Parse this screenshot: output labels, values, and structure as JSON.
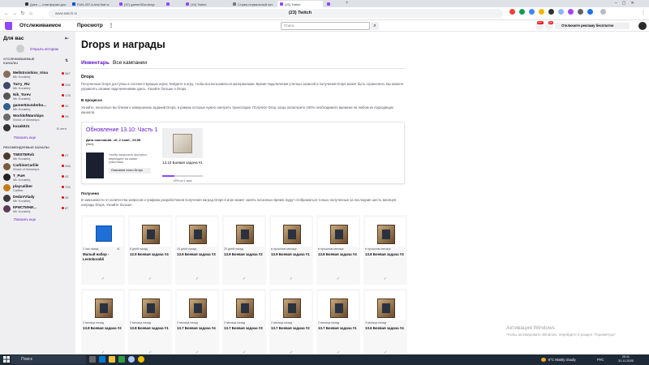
{
  "browser": {
    "tabs": [
      {
        "title": "Дзен — платформа для"
      },
      {
        "title": "FUN-337 A-test that w"
      },
      {
        "title": "(37) gamer52undergr"
      },
      {
        "title": ""
      },
      {
        "title": "(19) Twitch"
      },
      {
        "title": "Стрим-нервальный чат"
      },
      {
        "title": "(23) Twitch"
      },
      {
        "title": ""
      }
    ],
    "url": "www.twitch.tv",
    "page_title": "(23) Twitch"
  },
  "topnav": {
    "following": "Отслеживаемое",
    "browse": "Просмотр",
    "search_placeholder": "Поиск",
    "badge1": "99+",
    "badge2": "66",
    "adfree": "Отключите рекламу бесплатно"
  },
  "sidebar": {
    "heading": "Для вас",
    "history": "Открыть историю",
    "followed_header": "ОТСЛЕЖИВАЕМЫЕ КАНАЛЫ",
    "followed": [
      {
        "name": "Mellstroishiss_Irina",
        "game": "Mir Korablej",
        "viewers": "387",
        "color": "#8a6d5a"
      },
      {
        "name": "Turry_RU",
        "game": "Mir Korablej",
        "viewers": "226",
        "color": "#3b4a6b"
      },
      {
        "name": "Nik_Torev",
        "game": "Mir Korablej",
        "viewers": "178",
        "color": "#555"
      },
      {
        "name": "gamer52underbo...",
        "game": "Mir Korablej",
        "viewers": "42",
        "color": "#2f5f8f"
      },
      {
        "name": "WorldofWarships",
        "game": "World of Warships",
        "viewers": "28",
        "color": "#6b6b6b"
      },
      {
        "name": "kozak021",
        "game": "",
        "viewers": "В сети",
        "color": "#333"
      }
    ],
    "followed_more": "Показать еще",
    "recommended_header": "РЕКОМЕНДУЕМЫЕ КАНАЛЫ",
    "recommended": [
      {
        "name": "TWISTERvb",
        "game": "Mir Korablej",
        "viewers": "27",
        "color": "#4b3a2a"
      },
      {
        "name": "CarbinoCarlile",
        "game": "World of Warships",
        "viewers": "266",
        "color": "#7b5a3c"
      },
      {
        "name": "T_PuH",
        "game": "Mir Korablej",
        "viewers": "43",
        "color": "#222"
      },
      {
        "name": "playcaliber",
        "game": "Caliber",
        "viewers": "726",
        "color": "#c47a1a"
      },
      {
        "name": "DedaVVlady",
        "game": "Mir Korablej",
        "viewers": "35",
        "color": "#3a3a3a"
      },
      {
        "name": "КРИСТИНИ...",
        "game": "Mir Korablej",
        "viewers": "87",
        "color": "#5a3a5a"
      }
    ],
    "recommended_more": "Показать еще"
  },
  "main": {
    "title": "Drops и награды",
    "tab_inventory": "Инвентарь",
    "tab_all": "Все кампании",
    "drops_heading": "Drops",
    "drops_text": "Полученные Drops доступны в соответствующих играх. Войдите в игру, чтобы воспользоваться материалами. Время подключения учетных записей и получения Drops может быть ограничено. Вы можете управлять своими подключениями здесь. Узнайте больше о Drops.",
    "inprogress_heading": "В процессе",
    "inprogress_text": "Узнайте, насколько вы близки к завершению заданий Drops, в рамках которых нужно смотреть трансляции. Получите Drop, когда посмотрите 100% необходимого времени на любом из подходящих каналов.",
    "campaign": {
      "title": "Обновление 13.10: Часть 1",
      "end_label": "Дата окончания: сб, 2 нояб., 23:58",
      "end_remaining": "(Нет)",
      "note": "Чтобы зачислить прогресс, перейдите на канал участника.",
      "button": "Описание этого Drops",
      "drop_name": "13.10 Боевая задача #1",
      "progress_pct": 29,
      "progress_label": "29% из 4 часа"
    },
    "received_heading": "Получено",
    "received_text": "В зависимости от количества запросов и графика разработчиков получения наград Drops в игре может занять несколько время. Будут отображаться только полученные за последние шесть месяцев награды Drops. Узнайте больше.",
    "received_row1": [
      {
        "meta": "1 час назад",
        "count": "x1",
        "name": "Малый набор - Lestokorabli",
        "icon": "gift-box"
      },
      {
        "meta": "8 дней назад",
        "count": "",
        "name": "12.9 Боевая задача #4",
        "icon": "crate"
      },
      {
        "meta": "10 дней назад",
        "count": "",
        "name": "13.9 Боевая задача #3",
        "icon": "crate"
      },
      {
        "meta": "20 дней назад",
        "count": "",
        "name": "13.9 Боевая задача #2",
        "icon": "crate"
      },
      {
        "meta": "в прошлом месяце",
        "count": "",
        "name": "13.9 Боевая задача #1",
        "icon": "crate"
      },
      {
        "meta": "в прошлом месяце",
        "count": "",
        "name": "13.8 Боевая задача #4",
        "icon": "crate"
      },
      {
        "meta": "в прошлом месяце",
        "count": "",
        "name": "13.8 Боевая задача #3",
        "icon": "crate"
      }
    ],
    "received_row2": [
      {
        "meta": "2 месяца назад",
        "count": "",
        "name": "13.8 Боевая задача #2",
        "icon": "crate"
      },
      {
        "meta": "2 месяца назад",
        "count": "",
        "name": "13.8 Боевая задача #1",
        "icon": "crate"
      },
      {
        "meta": "2 месяца назад",
        "count": "",
        "name": "13.7 Боевая задача #4",
        "icon": "crate"
      },
      {
        "meta": "2 месяца назад",
        "count": "",
        "name": "13.7 Боевая задача #3",
        "icon": "crate"
      },
      {
        "meta": "2 месяца назад",
        "count": "",
        "name": "13.7 Боевая задача #2",
        "icon": "crate"
      },
      {
        "meta": "2 месяца назад",
        "count": "",
        "name": "13.7 Боевая задача #1",
        "icon": "crate"
      },
      {
        "meta": "3 месяца назад",
        "count": "",
        "name": "13.6 Боевая задача #4",
        "icon": "crate"
      }
    ]
  },
  "watermark": {
    "line1": "Активация Windows",
    "line2": "Чтобы активировать Windows, перейдите в раздел \"Параметры\"."
  },
  "taskbar": {
    "search": "Поиск",
    "weather": "8°C Mostly cloudy",
    "lang": "РУС",
    "time": "20:11",
    "date": "31.11.2026"
  }
}
